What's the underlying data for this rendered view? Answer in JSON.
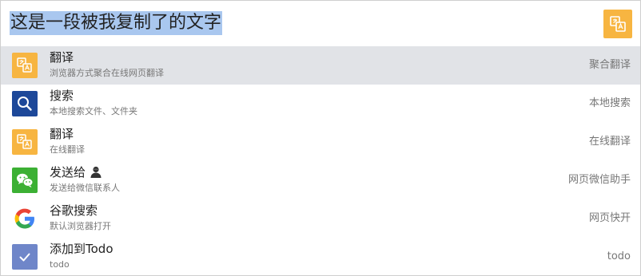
{
  "search": {
    "query": "这是一段被我复制了的文字"
  },
  "colors": {
    "accent": "#f7b541",
    "selected_row": "#e1e3e7",
    "highlight": "#a9c7ef"
  },
  "results": [
    {
      "icon": "translate-icon",
      "title": "翻译",
      "subtitle": "浏览器方式聚合在线网页翻译",
      "right": "聚合翻译",
      "selected": true
    },
    {
      "icon": "search-icon",
      "title": "搜索",
      "subtitle": "本地搜索文件、文件夹",
      "right": "本地搜索",
      "selected": false
    },
    {
      "icon": "translate-icon",
      "title": "翻译",
      "subtitle": "在线翻译",
      "right": "在线翻译",
      "selected": false
    },
    {
      "icon": "wechat-icon",
      "title": "发送给",
      "subtitle": "发送给微信联系人",
      "right": "网页微信助手",
      "selected": false,
      "title_icon": "contact-avatar-icon"
    },
    {
      "icon": "google-icon",
      "title": "谷歌搜索",
      "subtitle": "默认浏览器打开",
      "right": "网页快开",
      "selected": false
    },
    {
      "icon": "todo-icon",
      "title": "添加到Todo",
      "subtitle": "todo",
      "right": "todo",
      "selected": false
    }
  ]
}
